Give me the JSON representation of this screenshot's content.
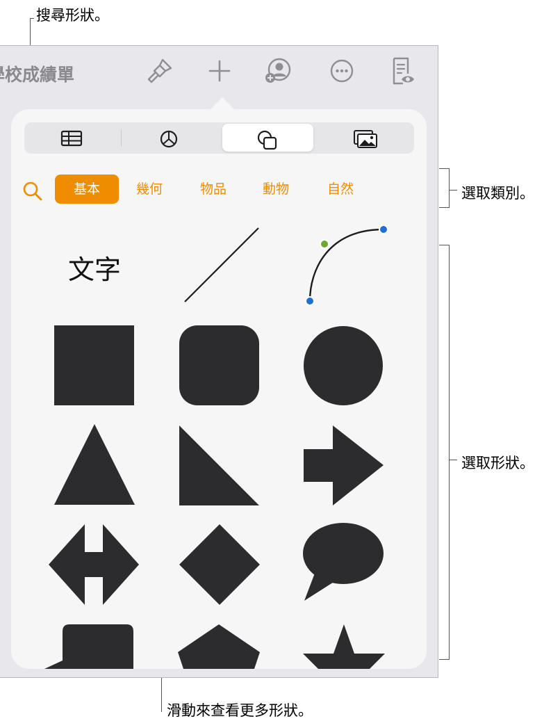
{
  "callouts": {
    "search": "搜尋形狀。",
    "categories": "選取類別。",
    "shapes": "選取形狀。",
    "scroll": "滑動來查看更多形狀。"
  },
  "toolbar": {
    "doc_title": "學校成績單",
    "icons": [
      "paintbrush-icon",
      "add-icon",
      "collaborate-icon",
      "more-icon",
      "reader-view-icon"
    ]
  },
  "segments": {
    "items": [
      "table-icon",
      "chart-icon",
      "shape-icon",
      "media-icon"
    ],
    "selected": "shape-icon"
  },
  "categories": {
    "items": [
      "基本",
      "幾何",
      "物品",
      "動物",
      "自然"
    ],
    "selected": "基本"
  },
  "shapes": {
    "text_label": "文字",
    "items": [
      "text",
      "line",
      "curve",
      "square",
      "rounded-square",
      "circle",
      "triangle",
      "right-triangle",
      "arrow",
      "double-arrow",
      "diamond",
      "speech-bubble",
      "callout-box",
      "pentagon",
      "star"
    ],
    "fill_color": "#2c2c2e",
    "curve_point_colors": [
      "#1f6fd8",
      "#6aaa2c"
    ]
  },
  "colors": {
    "accent": "#f08c00"
  }
}
